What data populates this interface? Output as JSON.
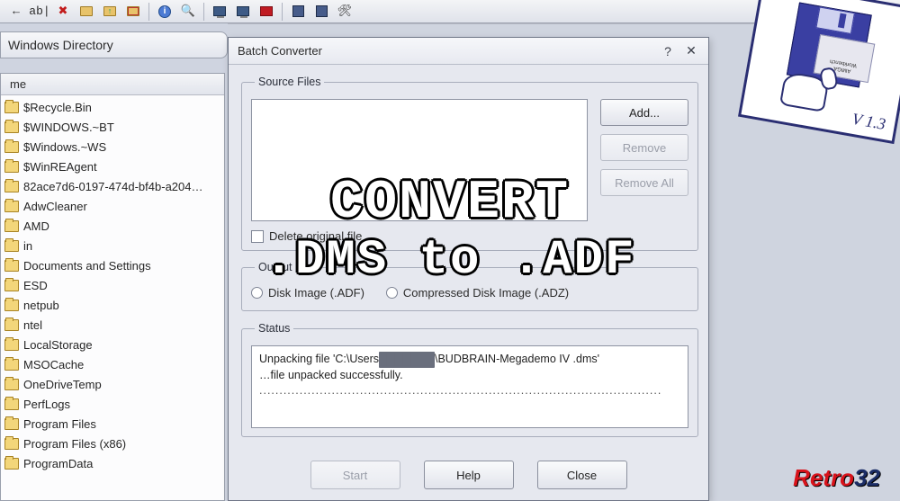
{
  "toolbar": {
    "buttons": [
      {
        "name": "nav-back-icon",
        "glyph": "←"
      },
      {
        "name": "rename-icon",
        "glyph": "ab|"
      },
      {
        "name": "delete-icon",
        "glyph": "✖",
        "color": "#c21b1b"
      },
      {
        "name": "open-folder-icon",
        "type": "folder"
      },
      {
        "name": "folder-up-icon",
        "type": "folder-up"
      },
      {
        "name": "folder-tree-icon",
        "type": "folder-red"
      },
      {
        "sep": true
      },
      {
        "name": "info-icon",
        "type": "info",
        "glyph": "i"
      },
      {
        "name": "find-icon",
        "glyph": "🔍"
      },
      {
        "sep": true
      },
      {
        "name": "screen1-icon",
        "type": "monitor"
      },
      {
        "name": "screen2-icon",
        "type": "monitor"
      },
      {
        "name": "flag-icon",
        "type": "flag"
      },
      {
        "sep": true
      },
      {
        "name": "disk1-icon",
        "type": "disk"
      },
      {
        "name": "disk2-icon",
        "type": "disk"
      },
      {
        "name": "tools-icon",
        "glyph": "🛠"
      }
    ]
  },
  "browse_bar": {
    "label": "Windows Directory"
  },
  "file_list": {
    "column": "me",
    "items": [
      "$Recycle.Bin",
      "$WINDOWS.~BT",
      "$Windows.~WS",
      "$WinREAgent",
      "82ace7d6-0197-474d-bf4b-a204…",
      "AdwCleaner",
      "AMD",
      "in",
      "Documents and Settings",
      "ESD",
      "netpub",
      "ntel",
      "LocalStorage",
      "MSOCache",
      "OneDriveTemp",
      "PerfLogs",
      "Program Files",
      "Program Files (x86)",
      "ProgramData"
    ]
  },
  "dialog": {
    "title": "Batch Converter",
    "help_label": "?",
    "close_glyph": "✕",
    "groups": {
      "source": {
        "legend": "Source Files",
        "add": "Add...",
        "remove": "Remove",
        "remove_all": "Remove All",
        "delete_chk": "Delete original file"
      },
      "output": {
        "legend": "Output",
        "opt1": "Disk Image (.ADF)",
        "opt2": "Compressed Disk Image (.ADZ)"
      },
      "status": {
        "legend": "Status",
        "line1a": "Unpacking file 'C:\\Users",
        "line1_redacted": "███████",
        "line1b": "\\BUDBRAIN-Megademo IV .dms'",
        "line2": "…file unpacked successfully.",
        "dots": "...................................................................................................."
      }
    },
    "buttons": {
      "start": "Start",
      "help": "Help",
      "close": "Close"
    }
  },
  "overlay": {
    "line1": "CONVERT",
    "line2": ".DMS to .ADF"
  },
  "floppy": {
    "label1": "AMIGA",
    "label2": "Workbench",
    "version": "V 1.3"
  },
  "brand": {
    "part1": "Retro",
    "part2": "32"
  }
}
